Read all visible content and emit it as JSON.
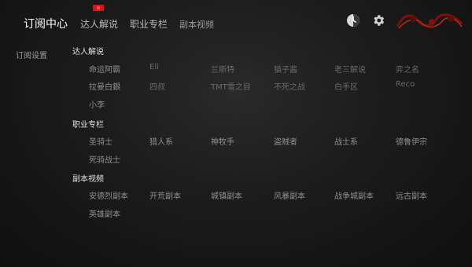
{
  "tabs": [
    {
      "label": "订阅中心",
      "active": true
    },
    {
      "label": "达人解说",
      "active": false
    },
    {
      "label": "职业专栏",
      "active": false
    },
    {
      "label": "副本视频",
      "active": false
    }
  ],
  "topbar": {
    "timer_icon": "timer-icon",
    "settings_icon": "gear-icon",
    "logo_text": "魔兽世界"
  },
  "sidebar": {
    "subscription_settings": "订阅设置"
  },
  "sections": [
    {
      "title": "达人解说",
      "items": [
        "命运阿霸",
        "Eli",
        "兰斯特",
        "猫子酱",
        "老三解说",
        "弈之名",
        "拉曼白銀",
        "四叔",
        "TMT雪之目",
        "不死之战",
        "白手区",
        "Reco",
        "小李"
      ]
    },
    {
      "title": "职业专栏",
      "items": [
        "圣骑士",
        "猎人系",
        "神牧手",
        "盗贼者",
        "战士系",
        "德鲁伊宗",
        "死骑战士"
      ]
    },
    {
      "title": "副本视频",
      "items": [
        "安德烈副本",
        "开荒副本",
        "城镇副本",
        "风暴副本",
        "战争城副本",
        "远古副本",
        "英雄副本"
      ]
    }
  ],
  "colors": {
    "accent_red": "#d9151b",
    "active_tab": "#ffffff",
    "text": "#8f8f8f"
  }
}
